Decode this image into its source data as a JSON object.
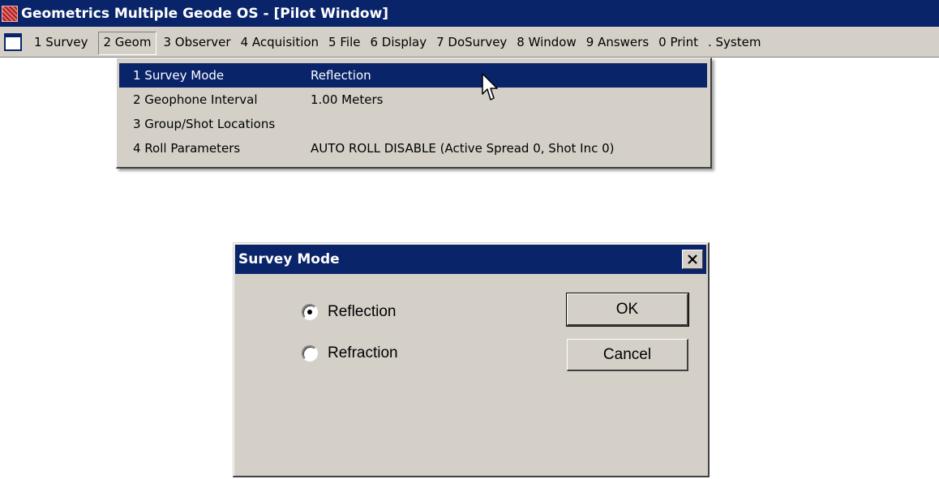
{
  "window": {
    "title": "Geometrics Multiple Geode OS - [Pilot Window]",
    "app_icon": "geode-app-icon"
  },
  "colors": {
    "titlebar": "#0a246a",
    "menu_bg": "#d4d0c8",
    "highlight": "#0a246a"
  },
  "menubar": {
    "doc_icon": "document-window-icon",
    "items": [
      {
        "label": "1 Survey"
      },
      {
        "label": "2 Geom",
        "open": true
      },
      {
        "label": "3 Observer"
      },
      {
        "label": "4 Acquisition"
      },
      {
        "label": "5 File"
      },
      {
        "label": "6 Display"
      },
      {
        "label": "7 DoSurvey"
      },
      {
        "label": "8 Window"
      },
      {
        "label": "9 Answers"
      },
      {
        "label": "0 Print"
      },
      {
        "label": ". System"
      }
    ]
  },
  "geom_menu": {
    "items": [
      {
        "label": "1 Survey Mode",
        "value": "Reflection",
        "highlighted": true
      },
      {
        "label": "2 Geophone Interval",
        "value": "1.00  Meters"
      },
      {
        "label": "3 Group/Shot Locations",
        "value": ""
      },
      {
        "label": "4 Roll Parameters",
        "value": "AUTO ROLL DISABLE (Active Spread 0, Shot Inc 0)"
      }
    ]
  },
  "dialog": {
    "title": "Survey Mode",
    "close_icon": "close-icon",
    "options": [
      {
        "label": "Reflection",
        "selected": true
      },
      {
        "label": "Refraction",
        "selected": false
      }
    ],
    "ok_label": "OK",
    "cancel_label": "Cancel"
  }
}
